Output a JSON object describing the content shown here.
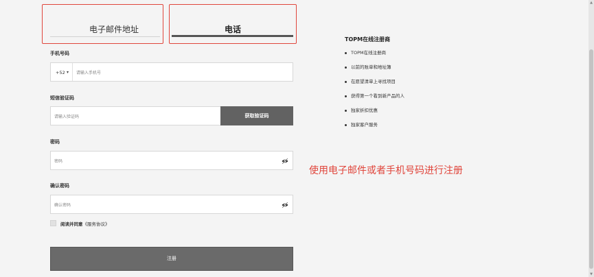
{
  "tabs": {
    "email_label": "电子邮件地址",
    "phone_label": "电话"
  },
  "phone": {
    "label": "手机号码",
    "country_code": "+52",
    "placeholder": "请输入手机号"
  },
  "sms": {
    "label": "短信验证码",
    "placeholder": "请输入验证码",
    "button_label": "获取验证码"
  },
  "password": {
    "label": "密码",
    "placeholder": "密码"
  },
  "confirm_password": {
    "label": "确认密码",
    "placeholder": "确认密码"
  },
  "agreement": {
    "prefix": "阅读并同意",
    "link": "《服务协议》"
  },
  "register_button": "注册",
  "sidebar": {
    "title": "TOPM在线注册商",
    "items": [
      "TOPM在线注册商",
      "以前的账单和地址簿",
      "在愿望清单上寻找项目",
      "获得第一个看到新产品的人",
      "独家折扣优惠",
      "独家客户服务"
    ]
  },
  "annotation": "使用电子邮件或者手机号码进行注册",
  "colors": {
    "highlight": "#e0443a",
    "button": "#626262"
  },
  "icons": [
    "eye-icon",
    "chevron-down-icon"
  ]
}
